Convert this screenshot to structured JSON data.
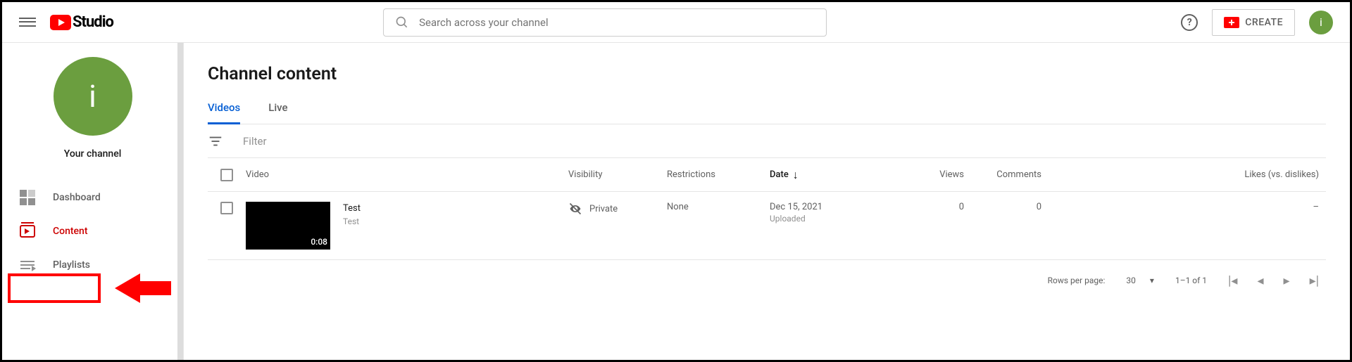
{
  "header": {
    "logo_text": "Studio",
    "search_placeholder": "Search across your channel",
    "create_label": "CREATE",
    "avatar_initial": "i"
  },
  "sidebar": {
    "channel_initial": "i",
    "channel_label": "Your channel",
    "items": [
      {
        "label": "Dashboard"
      },
      {
        "label": "Content"
      },
      {
        "label": "Playlists"
      }
    ]
  },
  "main": {
    "title": "Channel content",
    "tabs": [
      {
        "label": "Videos"
      },
      {
        "label": "Live"
      }
    ],
    "filter_label": "Filter",
    "columns": {
      "video": "Video",
      "visibility": "Visibility",
      "restrictions": "Restrictions",
      "date": "Date",
      "views": "Views",
      "comments": "Comments",
      "likes": "Likes (vs. dislikes)"
    },
    "rows": [
      {
        "title": "Test",
        "description": "Test",
        "duration": "0:08",
        "visibility": "Private",
        "restrictions": "None",
        "date": "Dec 15, 2021",
        "date_sub": "Uploaded",
        "views": "0",
        "comments": "0",
        "likes": "–"
      }
    ],
    "footer": {
      "rows_per_page_label": "Rows per page:",
      "rows_per_page_value": "30",
      "range": "1–1 of 1"
    }
  }
}
